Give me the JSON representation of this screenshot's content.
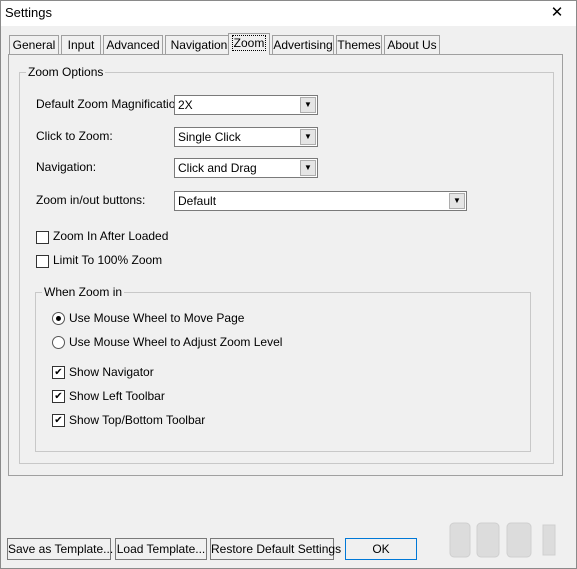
{
  "window": {
    "title": "Settings",
    "close_glyph": "✕"
  },
  "tabs": [
    "General",
    "Input",
    "Advanced",
    "Navigation",
    "Zoom",
    "Advertising",
    "Themes",
    "About Us"
  ],
  "zoom_options": {
    "legend": "Zoom Options",
    "magnification": {
      "label": "Default Zoom Magnification:",
      "value": "2X"
    },
    "click_to_zoom": {
      "label": "Click to Zoom:",
      "value": "Single Click"
    },
    "navigation": {
      "label": "Navigation:",
      "value": "Click and Drag"
    },
    "zoom_buttons": {
      "label": "Zoom in/out buttons:",
      "value": "Default"
    },
    "zoom_in_after_loaded": {
      "label": "Zoom In After Loaded",
      "checked": false
    },
    "limit_100": {
      "label": "Limit To 100% Zoom",
      "checked": false
    }
  },
  "when_zoom_in": {
    "legend": "When Zoom in",
    "wheel_move": {
      "label": "Use Mouse Wheel to Move Page",
      "selected": true
    },
    "wheel_zoom": {
      "label": "Use Mouse Wheel to Adjust Zoom Level",
      "selected": false
    },
    "show_navigator": {
      "label": "Show Navigator",
      "checked": true
    },
    "show_left_toolbar": {
      "label": "Show Left Toolbar",
      "checked": true
    },
    "show_top_bottom_toolbar": {
      "label": "Show Top/Bottom Toolbar",
      "checked": true
    }
  },
  "buttons": {
    "save_template": "Save as Template...",
    "load_template": "Load Template...",
    "restore_defaults": "Restore Default Settings",
    "ok": "OK"
  },
  "glyphs": {
    "check": "✔",
    "arrow": "▼"
  },
  "colors": {
    "accent": "#0078d7",
    "panel": "#f0f0f0"
  }
}
